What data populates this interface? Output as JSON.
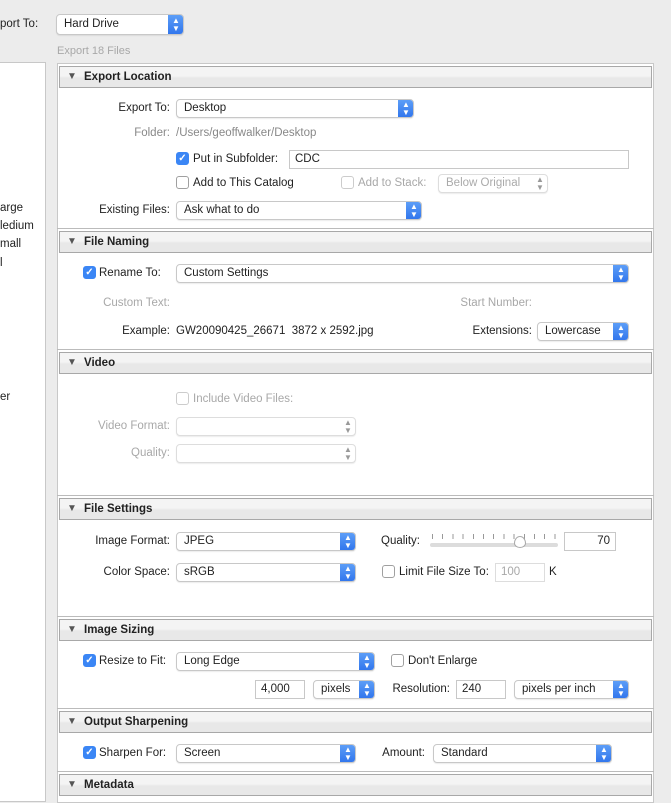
{
  "top": {
    "export_to_label": "port To:",
    "export_to_value": "Hard Drive",
    "file_count": "Export 18 Files"
  },
  "left_panel": {
    "items": [
      "arge",
      "ledium",
      "mall",
      "l",
      "er"
    ]
  },
  "export_location": {
    "title": "Export Location",
    "export_to_label": "Export To:",
    "export_to_value": "Desktop",
    "folder_label": "Folder:",
    "folder_value": "/Users/geoffwalker/Desktop",
    "subfolder_label": "Put in Subfolder:",
    "subfolder_checked": true,
    "subfolder_value": "CDC",
    "add_catalog_label": "Add to This Catalog",
    "add_catalog_checked": false,
    "add_stack_label": "Add to Stack:",
    "add_stack_value": "Below Original",
    "existing_label": "Existing Files:",
    "existing_value": "Ask what to do"
  },
  "file_naming": {
    "title": "File Naming",
    "rename_label": "Rename To:",
    "rename_checked": true,
    "rename_value": "Custom Settings",
    "custom_text_label": "Custom Text:",
    "start_number_label": "Start Number:",
    "example_label": "Example:",
    "example_value": "GW20090425_26671  3872 x 2592.jpg",
    "extensions_label": "Extensions:",
    "extensions_value": "Lowercase"
  },
  "video": {
    "title": "Video",
    "include_label": "Include Video Files:",
    "include_checked": false,
    "format_label": "Video Format:",
    "quality_label": "Quality:"
  },
  "file_settings": {
    "title": "File Settings",
    "format_label": "Image Format:",
    "format_value": "JPEG",
    "quality_label": "Quality:",
    "quality_value": "70",
    "quality_percent": 70,
    "color_label": "Color Space:",
    "color_value": "sRGB",
    "limit_label": "Limit File Size To:",
    "limit_checked": false,
    "limit_value": "100",
    "limit_unit": "K"
  },
  "image_sizing": {
    "title": "Image Sizing",
    "resize_label": "Resize to Fit:",
    "resize_checked": true,
    "resize_value": "Long Edge",
    "dont_enlarge_label": "Don't Enlarge",
    "dont_enlarge_checked": false,
    "size_value": "4,000",
    "size_unit": "pixels",
    "resolution_label": "Resolution:",
    "resolution_value": "240",
    "resolution_unit": "pixels per inch"
  },
  "output_sharpening": {
    "title": "Output Sharpening",
    "sharpen_label": "Sharpen For:",
    "sharpen_checked": true,
    "sharpen_value": "Screen",
    "amount_label": "Amount:",
    "amount_value": "Standard"
  },
  "metadata": {
    "title": "Metadata"
  },
  "icons": {
    "popup": "up-down-chevron-icon",
    "disclosure": "triangle-down-icon",
    "check": "checkmark-icon"
  },
  "colors": {
    "accent": "#3b86f5",
    "background": "#ececec"
  }
}
